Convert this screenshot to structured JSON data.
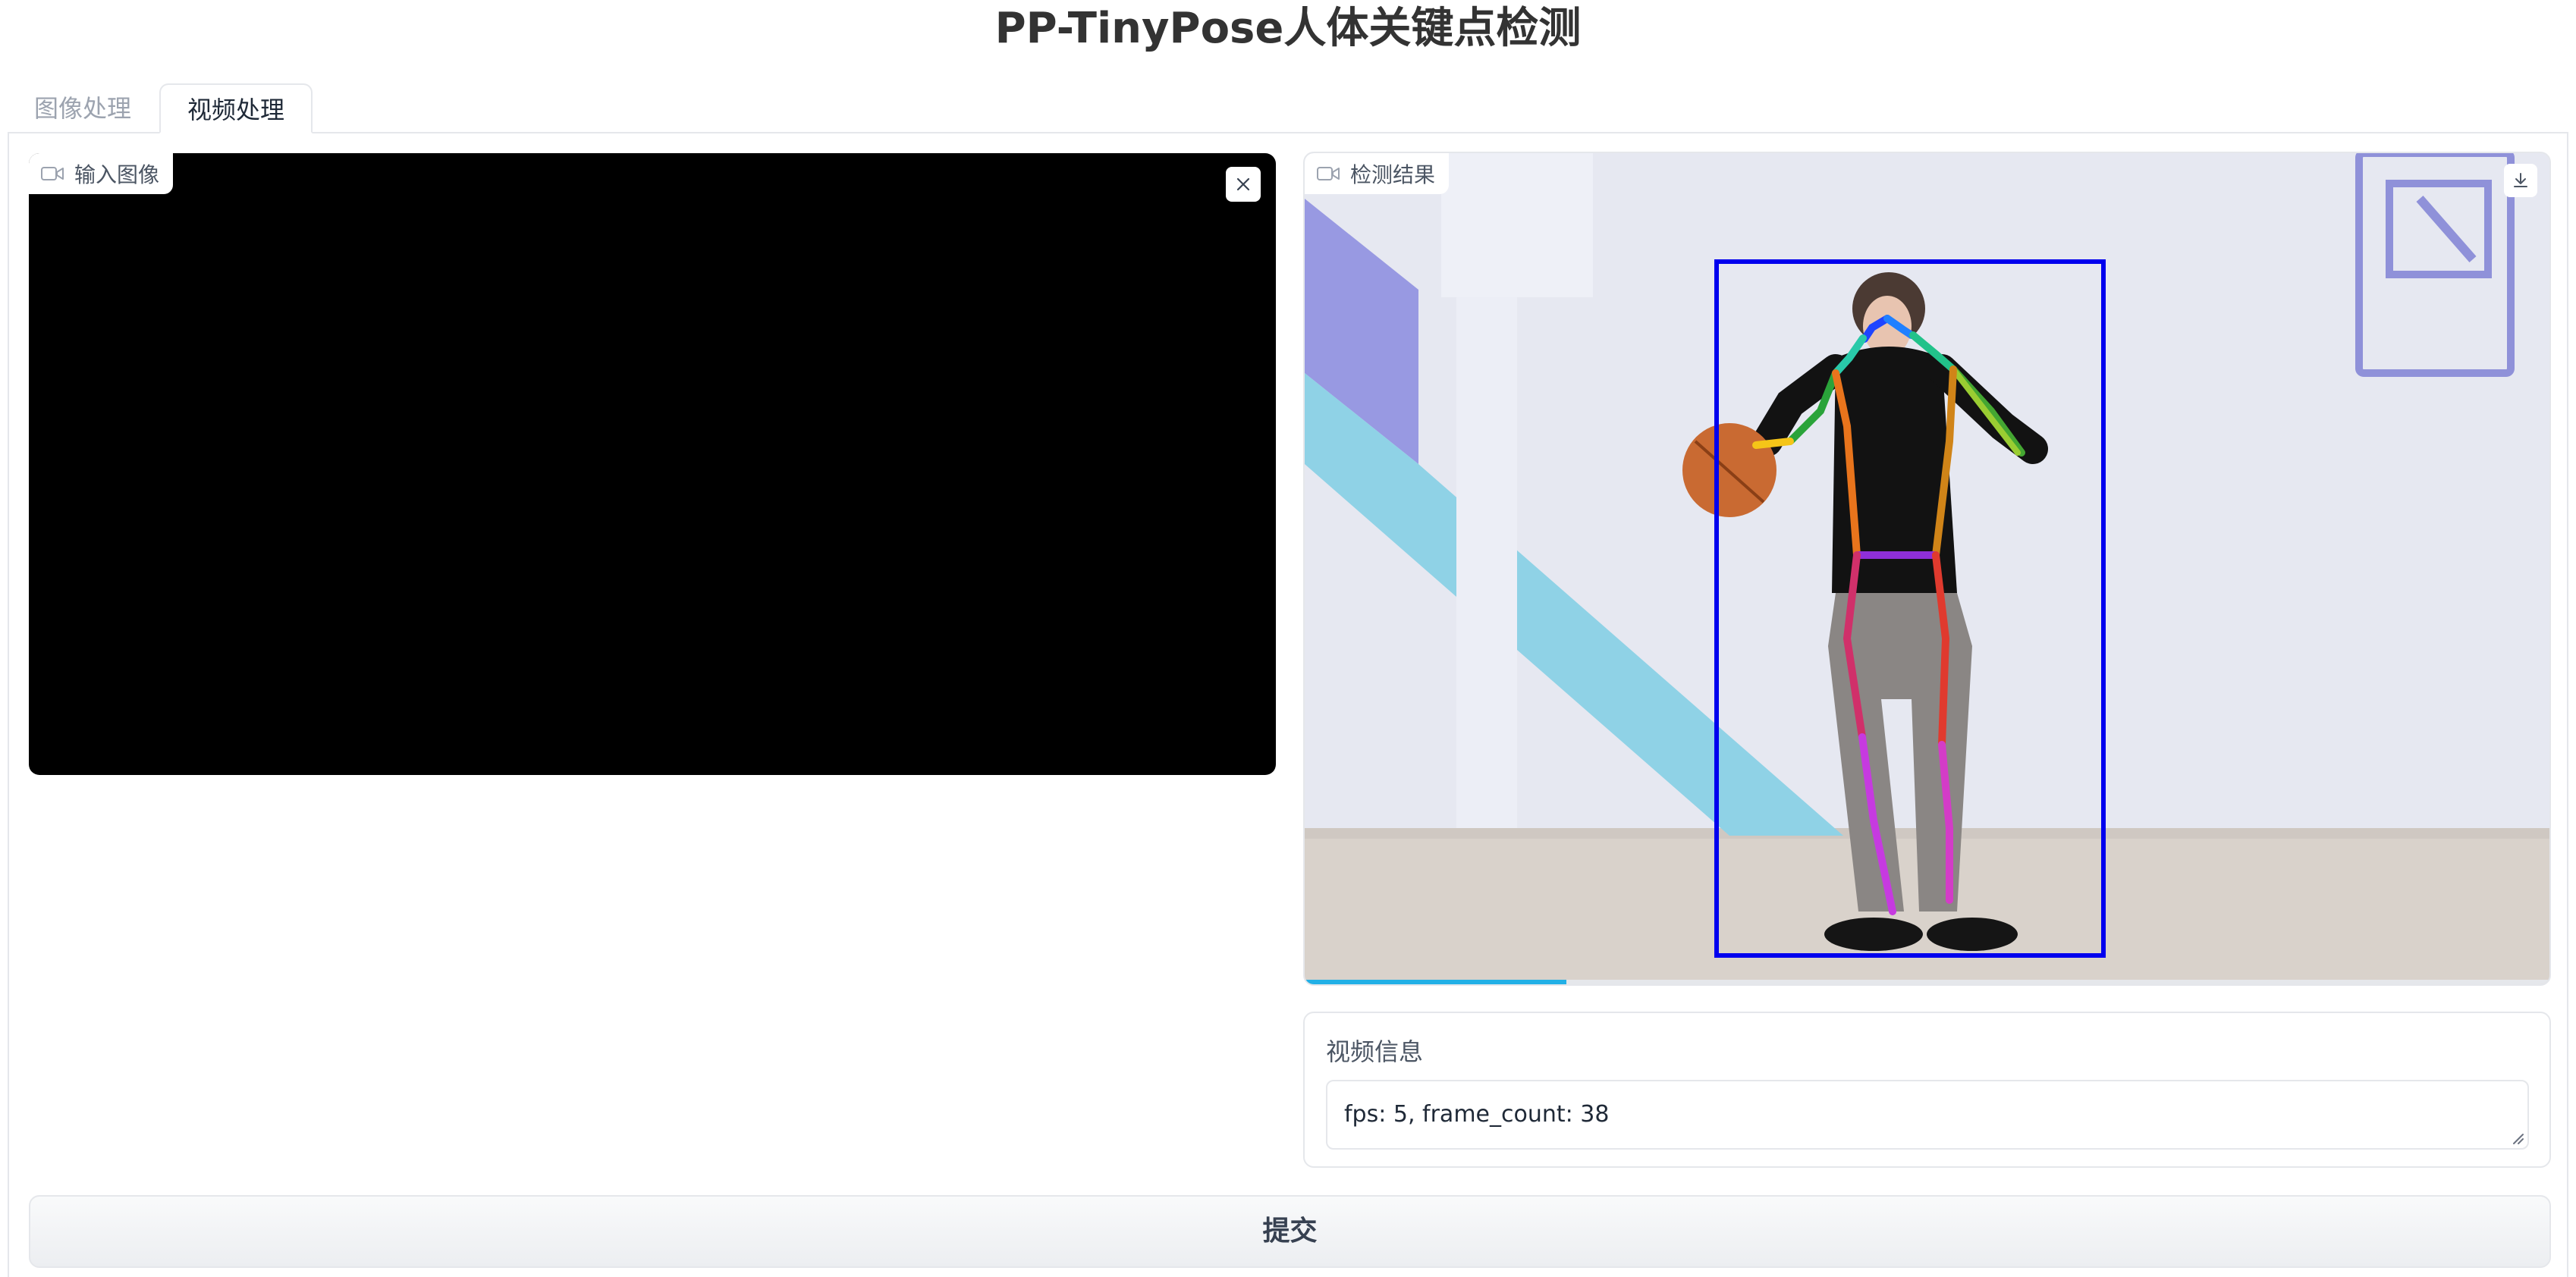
{
  "page": {
    "title": "PP-TinyPose人体关键点检测"
  },
  "tabs": [
    {
      "label": "图像处理",
      "selected": false
    },
    {
      "label": "视频处理",
      "selected": true
    }
  ],
  "input_video": {
    "label": "输入图像",
    "icon": "video-camera-icon",
    "close_icon": "close-icon"
  },
  "output_video": {
    "label": "检测结果",
    "icon": "video-camera-icon",
    "download_icon": "download-icon",
    "playback_progress": 0.21,
    "bounding_box_color": "#0000ee"
  },
  "video_info": {
    "label": "视频信息",
    "value": "fps: 5, frame_count: 38"
  },
  "submit": {
    "label": "提交"
  },
  "colors": {
    "accent_progress": "#22b0e6",
    "border": "#e5e7eb",
    "title_text": "#333333"
  }
}
